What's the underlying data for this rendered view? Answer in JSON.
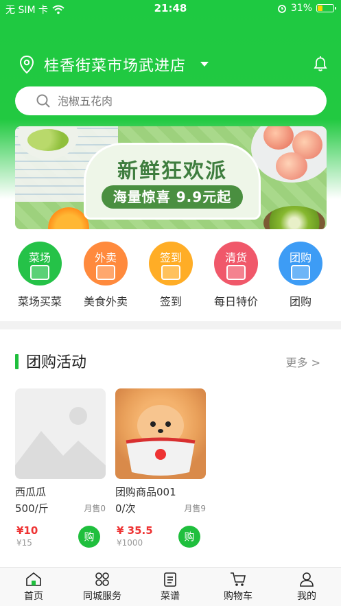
{
  "status": {
    "carrier": "无 SIM 卡",
    "time": "21:48",
    "battery": "31%",
    "battery_level": 0.31
  },
  "header": {
    "store_name": "桂香街菜市场武进店"
  },
  "search": {
    "placeholder": "泡椒五花肉"
  },
  "banner": {
    "headline": "新鲜狂欢派",
    "subline": "海量惊喜 9.9元起"
  },
  "categories": [
    {
      "tag": "菜场",
      "label": "菜场买菜",
      "color": "#25c248"
    },
    {
      "tag": "外卖",
      "label": "美食外卖",
      "color": "#ff8a3d"
    },
    {
      "tag": "签到",
      "label": "签到",
      "color": "#ffad26"
    },
    {
      "tag": "清货",
      "label": "每日特价",
      "color": "#f0586a"
    },
    {
      "tag": "团购",
      "label": "团购",
      "color": "#3d9cf5"
    }
  ],
  "group_buy": {
    "title": "团购活动",
    "more": "更多 >",
    "products": [
      {
        "name": "西瓜瓜",
        "unit": "500/斤",
        "sold": "月售0",
        "price": "¥10",
        "original": "¥15",
        "buy": "购"
      },
      {
        "name": "团购商品001",
        "unit": "0/次",
        "sold": "月售9",
        "price": "¥ 35.5",
        "original": "¥1000",
        "buy": "购"
      }
    ]
  },
  "tabbar": [
    {
      "label": "首页",
      "icon": "home-icon"
    },
    {
      "label": "同城服务",
      "icon": "grid-icon"
    },
    {
      "label": "菜谱",
      "icon": "recipe-icon"
    },
    {
      "label": "购物车",
      "icon": "cart-icon"
    },
    {
      "label": "我的",
      "icon": "user-icon"
    }
  ]
}
